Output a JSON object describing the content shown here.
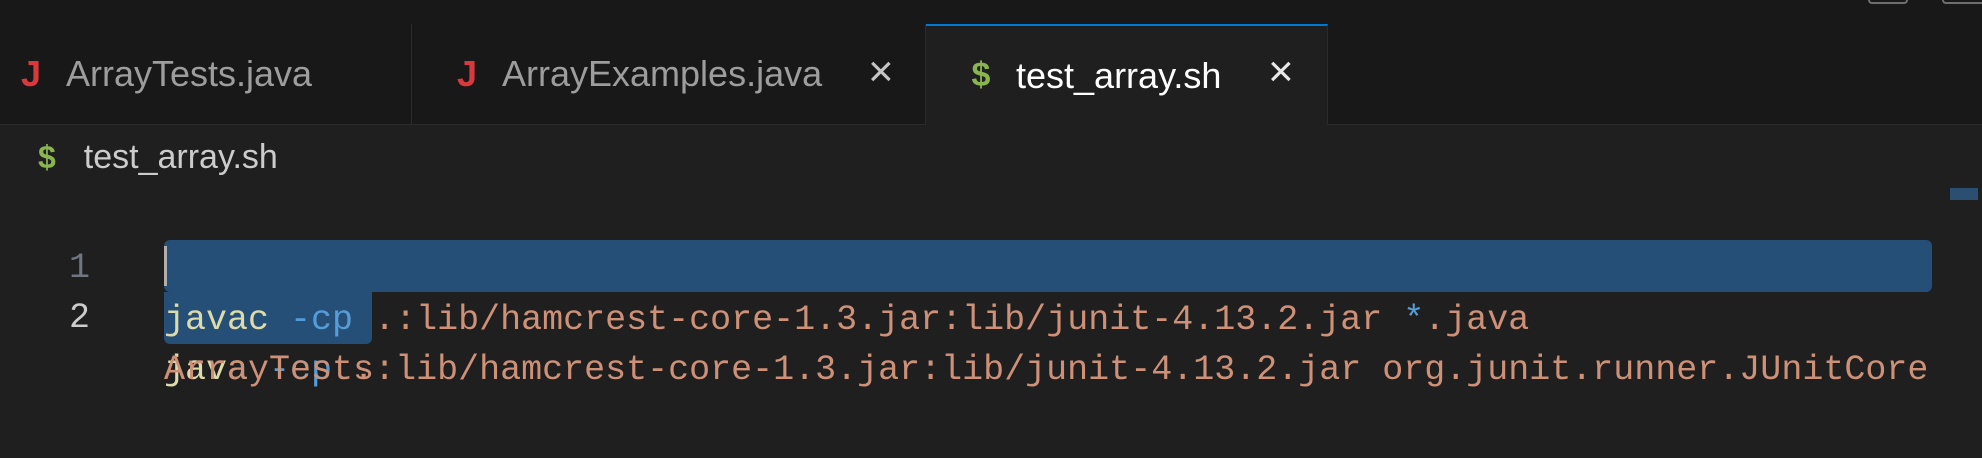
{
  "tabs": [
    {
      "icon": "J",
      "label": "ArrayTests.java",
      "active": false,
      "closable": false
    },
    {
      "icon": "J",
      "label": "ArrayExamples.java",
      "active": false,
      "closable": true
    },
    {
      "icon": "$",
      "label": "test_array.sh",
      "active": true,
      "closable": true
    }
  ],
  "close_glyph": "×",
  "breadcrumb": {
    "icon": "$",
    "label": "test_array.sh"
  },
  "editor": {
    "line_numbers": [
      "1",
      "2"
    ],
    "line1": {
      "cmd": "javac",
      "flag": "-cp",
      "path": ".:lib/hamcrest-core-1.3.jar:lib/junit-4.13.2.jar",
      "glob_op": "*",
      "glob_rest": ".java"
    },
    "line2": {
      "cmd": "java",
      "flag": "-cp",
      "path": ".:lib/hamcrest-core-1.3.jar:lib/junit-4.13.2.jar",
      "runner": "org.junit.runner.JUnitCore",
      "wrap": "ArrayTests"
    }
  },
  "colors": {
    "accent": "#0078d4",
    "java_icon": "#d9383c",
    "shell_icon": "#89b44f",
    "selection": "#264f78"
  }
}
